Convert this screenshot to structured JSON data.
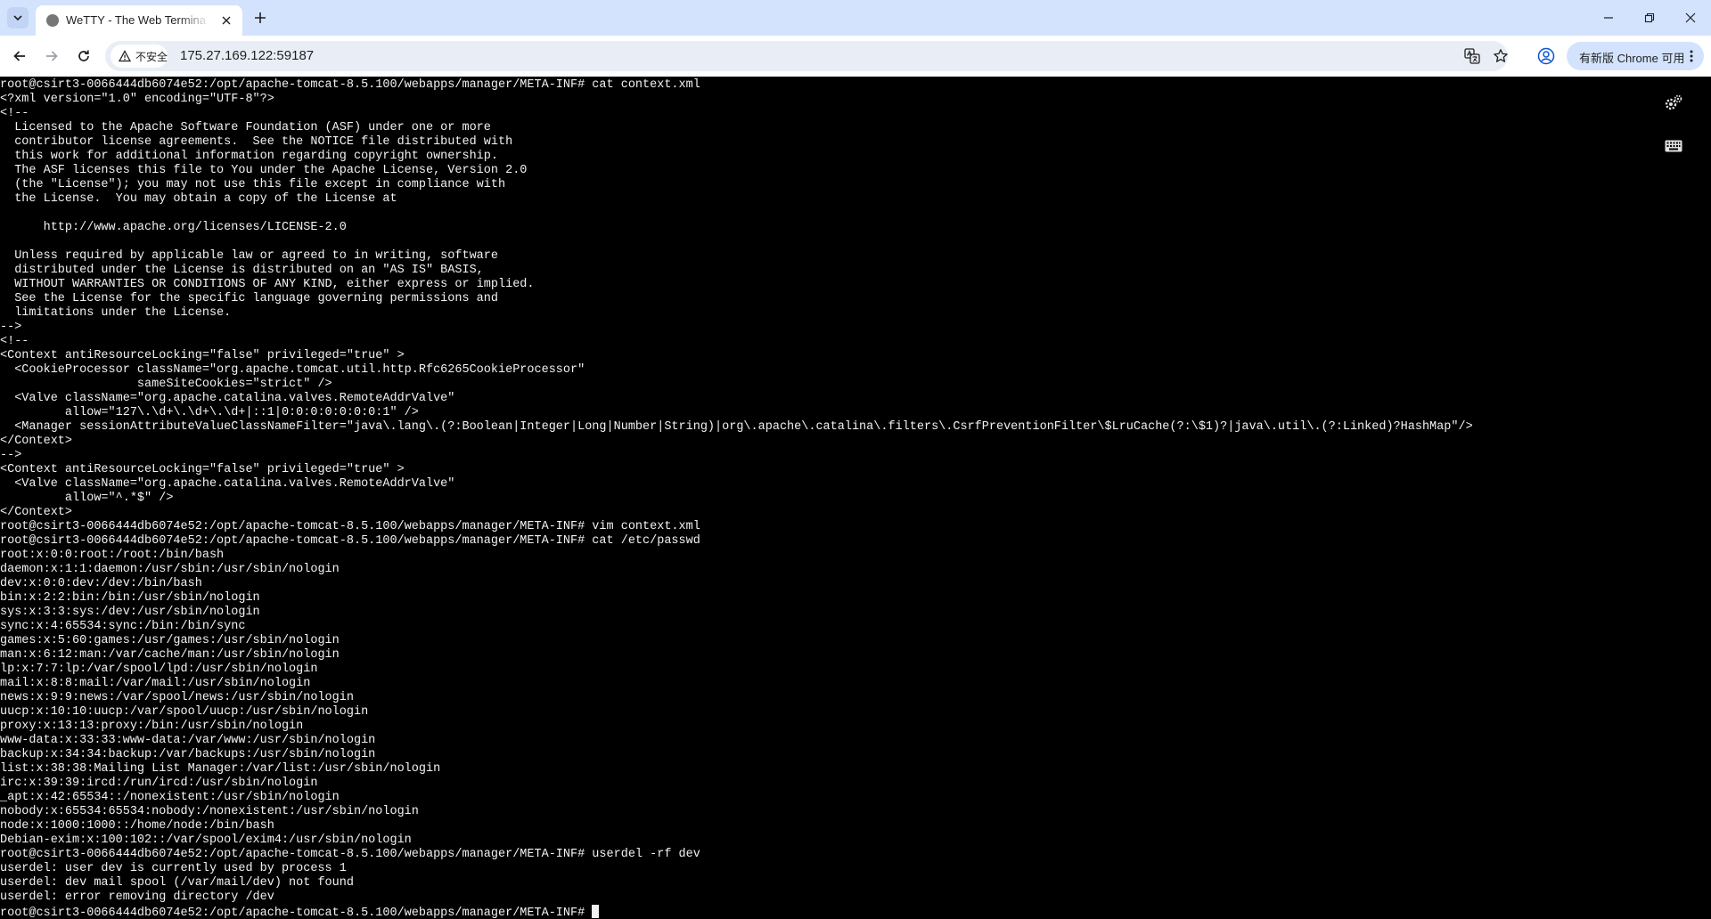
{
  "browser": {
    "tab": {
      "title": "WeTTY - The Web Terminal Emulator"
    },
    "address_bar": {
      "security_label": "不安全",
      "url": "175.27.169.122:59187"
    },
    "update_button": {
      "label": "有新版 Chrome 可用"
    },
    "colors": {
      "tabbar_bg": "#d3e3fd",
      "toolbar_bg": "#ffffff",
      "omnibox_bg": "#e9eef6",
      "terminal_bg": "#000000",
      "terminal_fg": "#f2f2f2"
    },
    "icons": {
      "tab_search": "chevron-down-icon",
      "favicon": "globe-icon",
      "tab_close": "close-icon",
      "new_tab": "plus-icon",
      "back": "arrow-left-icon",
      "forward": "arrow-right-icon",
      "reload": "reload-icon",
      "security": "warning-triangle-icon",
      "translate": "translate-icon",
      "bookmark": "star-icon",
      "profile": "profile-icon",
      "menu": "kebab-icon",
      "minimize": "minimize-icon",
      "maximize": "restore-icon",
      "close_window": "close-icon",
      "wetty_settings": "gears-icon",
      "wetty_keyboard": "keyboard-icon"
    }
  },
  "terminal": {
    "lines": [
      "root@csirt3-0066444db6074e52:/opt/apache-tomcat-8.5.100/webapps/manager/META-INF# cat context.xml",
      "<?xml version=\"1.0\" encoding=\"UTF-8\"?>",
      "<!--",
      "  Licensed to the Apache Software Foundation (ASF) under one or more",
      "  contributor license agreements.  See the NOTICE file distributed with",
      "  this work for additional information regarding copyright ownership.",
      "  The ASF licenses this file to You under the Apache License, Version 2.0",
      "  (the \"License\"); you may not use this file except in compliance with",
      "  the License.  You may obtain a copy of the License at",
      "",
      "      http://www.apache.org/licenses/LICENSE-2.0",
      "",
      "  Unless required by applicable law or agreed to in writing, software",
      "  distributed under the License is distributed on an \"AS IS\" BASIS,",
      "  WITHOUT WARRANTIES OR CONDITIONS OF ANY KIND, either express or implied.",
      "  See the License for the specific language governing permissions and",
      "  limitations under the License.",
      "-->",
      "<!--",
      "<Context antiResourceLocking=\"false\" privileged=\"true\" >",
      "  <CookieProcessor className=\"org.apache.tomcat.util.http.Rfc6265CookieProcessor\"",
      "                   sameSiteCookies=\"strict\" />",
      "  <Valve className=\"org.apache.catalina.valves.RemoteAddrValve\"",
      "         allow=\"127\\.\\d+\\.\\d+\\.\\d+|::1|0:0:0:0:0:0:0:1\" />",
      "  <Manager sessionAttributeValueClassNameFilter=\"java\\.lang\\.(?:Boolean|Integer|Long|Number|String)|org\\.apache\\.catalina\\.filters\\.CsrfPreventionFilter\\$LruCache(?:\\$1)?|java\\.util\\.(?:Linked)?HashMap\"/>",
      "</Context>",
      "-->",
      "<Context antiResourceLocking=\"false\" privileged=\"true\" >",
      "  <Valve className=\"org.apache.catalina.valves.RemoteAddrValve\"",
      "         allow=\"^.*$\" />",
      "</Context>",
      "root@csirt3-0066444db6074e52:/opt/apache-tomcat-8.5.100/webapps/manager/META-INF# vim context.xml",
      "root@csirt3-0066444db6074e52:/opt/apache-tomcat-8.5.100/webapps/manager/META-INF# cat /etc/passwd",
      "root:x:0:0:root:/root:/bin/bash",
      "daemon:x:1:1:daemon:/usr/sbin:/usr/sbin/nologin",
      "dev:x:0:0:dev:/dev:/bin/bash",
      "bin:x:2:2:bin:/bin:/usr/sbin/nologin",
      "sys:x:3:3:sys:/dev:/usr/sbin/nologin",
      "sync:x:4:65534:sync:/bin:/bin/sync",
      "games:x:5:60:games:/usr/games:/usr/sbin/nologin",
      "man:x:6:12:man:/var/cache/man:/usr/sbin/nologin",
      "lp:x:7:7:lp:/var/spool/lpd:/usr/sbin/nologin",
      "mail:x:8:8:mail:/var/mail:/usr/sbin/nologin",
      "news:x:9:9:news:/var/spool/news:/usr/sbin/nologin",
      "uucp:x:10:10:uucp:/var/spool/uucp:/usr/sbin/nologin",
      "proxy:x:13:13:proxy:/bin:/usr/sbin/nologin",
      "www-data:x:33:33:www-data:/var/www:/usr/sbin/nologin",
      "backup:x:34:34:backup:/var/backups:/usr/sbin/nologin",
      "list:x:38:38:Mailing List Manager:/var/list:/usr/sbin/nologin",
      "irc:x:39:39:ircd:/run/ircd:/usr/sbin/nologin",
      "_apt:x:42:65534::/nonexistent:/usr/sbin/nologin",
      "nobody:x:65534:65534:nobody:/nonexistent:/usr/sbin/nologin",
      "node:x:1000:1000::/home/node:/bin/bash",
      "Debian-exim:x:100:102::/var/spool/exim4:/usr/sbin/nologin",
      "root@csirt3-0066444db6074e52:/opt/apache-tomcat-8.5.100/webapps/manager/META-INF# userdel -rf dev",
      "userdel: user dev is currently used by process 1",
      "userdel: dev mail spool (/var/mail/dev) not found",
      "userdel: error removing directory /dev",
      "root@csirt3-0066444db6074e52:/opt/apache-tomcat-8.5.100/webapps/manager/META-INF# "
    ]
  }
}
